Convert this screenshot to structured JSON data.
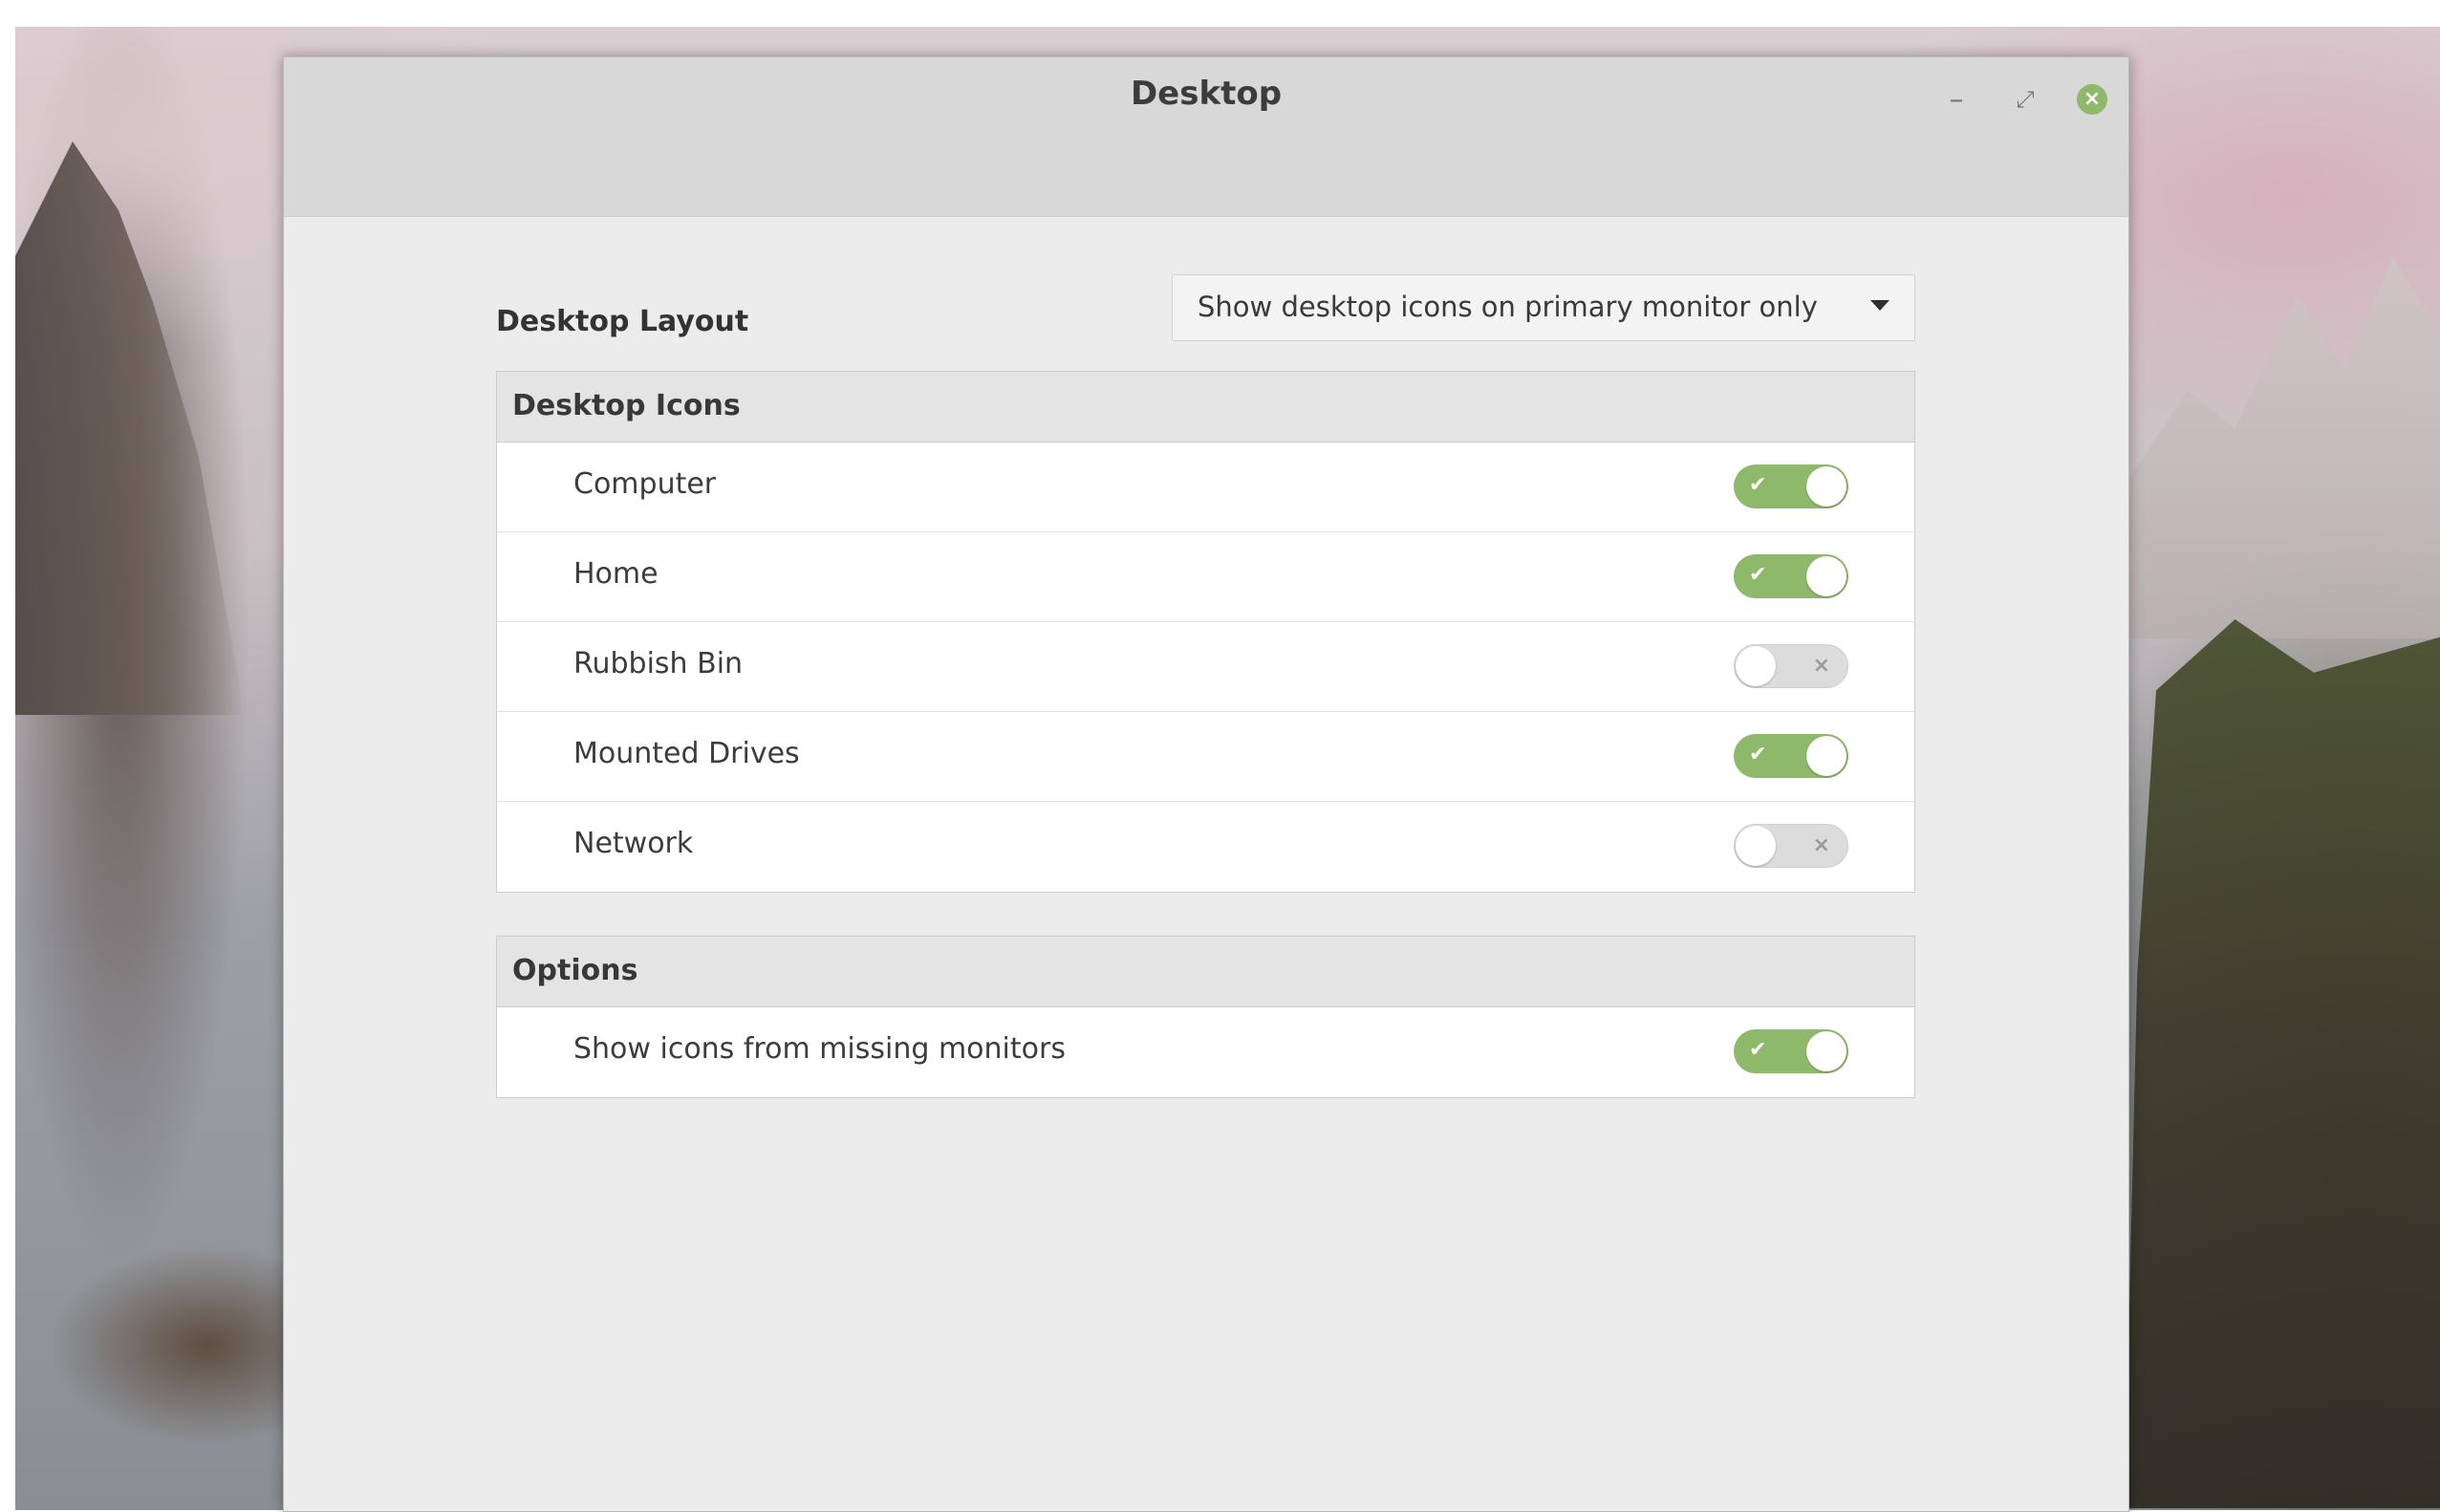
{
  "window": {
    "title": "Desktop",
    "controls": {
      "minimize_glyph": "–",
      "maximize_glyph": "⤢",
      "close_glyph": "×"
    }
  },
  "desktop_layout": {
    "label": "Desktop Layout",
    "selected": "Show desktop icons on primary monitor only"
  },
  "desktop_icons": {
    "header": "Desktop Icons",
    "items": [
      {
        "label": "Computer",
        "enabled": true,
        "mark": "✔"
      },
      {
        "label": "Home",
        "enabled": true,
        "mark": "✔"
      },
      {
        "label": "Rubbish Bin",
        "enabled": false,
        "mark": "×"
      },
      {
        "label": "Mounted Drives",
        "enabled": true,
        "mark": "✔"
      },
      {
        "label": "Network",
        "enabled": false,
        "mark": "×"
      }
    ]
  },
  "options": {
    "header": "Options",
    "items": [
      {
        "label": "Show icons from missing monitors",
        "enabled": true,
        "mark": "✔"
      }
    ]
  },
  "colors": {
    "accent": "#8fb96a",
    "toggle_off": "#dcdcdc"
  }
}
